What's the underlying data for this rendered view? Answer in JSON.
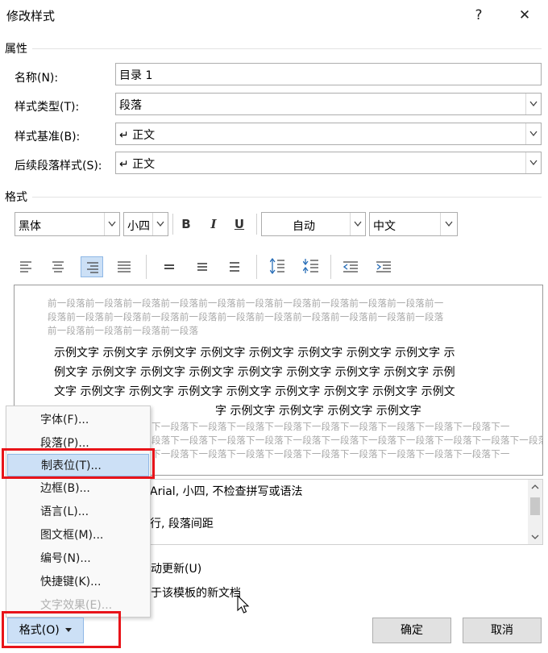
{
  "window": {
    "title": "修改样式",
    "help": "?",
    "close": "✕"
  },
  "properties": {
    "section_label": "属性",
    "name_label": "名称(N):",
    "name_value": "目录 1",
    "type_label": "样式类型(T):",
    "type_value": "段落",
    "based_label": "样式基准(B):",
    "based_value": "↵ 正文",
    "next_label": "后续段落样式(S):",
    "next_value": "↵ 正文"
  },
  "formatting": {
    "section_label": "格式",
    "font": "黑体",
    "size": "小四",
    "bold": "B",
    "italic": "I",
    "underline": "U",
    "color": "自动",
    "script": "中文"
  },
  "preview": {
    "prev_lines": [
      "前一段落前一段落前一段落前一段落前一段落前一段落前一段落前一段落前一段落前一段落前一",
      "段落前一段落前一段落前一段落前一段落前一段落前一段落前一段落前一段落前一段落前一段落",
      "前一段落前一段落前一段落前一段落"
    ],
    "sample_lines": [
      "示例文字 示例文字 示例文字 示例文字 示例文字 示例文字 示例文字 示例文字 示",
      "例文字 示例文字 示例文字 示例文字 示例文字 示例文字 示例文字 示例文字 示例",
      "文字 示例文字 示例文字 示例文字 示例文字 示例文字 示例文字 示例文字 示例文",
      "字 示例文字 示例文字 示例文字 示例文字"
    ],
    "next_lines": [
      "下一段落下一段落下一段落下一段落下一段落下一段落下一段落下一段落下一段落下一",
      "段落下一段落下一段落下一段落下一段落下一段落下一段落下一段落下一段落下一段落下一段落",
      "下一段落下一段落下一段落下一段落下一段落下一段落下一段落下一段落下一段落下一"
    ]
  },
  "description": {
    "line1": "Arial, 小四, 不检查拼写或语法",
    "line2": "行, 段落间距"
  },
  "options": {
    "auto_update": "动更新(U)",
    "new_docs": "于该模板的新文档"
  },
  "menu": {
    "items": [
      "字体(F)...",
      "段落(P)...",
      "制表位(T)...",
      "边框(B)...",
      "语言(L)...",
      "图文框(M)...",
      "编号(N)...",
      "快捷键(K)...",
      "文字效果(E)..."
    ],
    "highlighted_index": 2,
    "disabled_index": 8
  },
  "buttons": {
    "format": "格式(O)",
    "ok": "确定",
    "cancel": "取消"
  },
  "colors": {
    "accent": "#cce0f6",
    "highlight_border": "#e8141a"
  }
}
